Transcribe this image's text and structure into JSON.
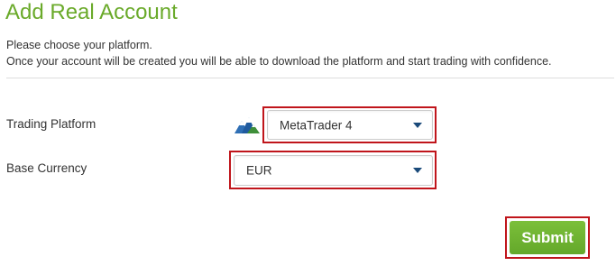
{
  "page": {
    "title": "Add Real Account",
    "intro_line_1": "Please choose your platform.",
    "intro_line_2": "Once your account will be created you will be able to download the platform and start trading with confidence."
  },
  "form": {
    "platform": {
      "label": "Trading Platform",
      "value": "MetaTrader 4",
      "icon": "metatrader-logo-icon"
    },
    "currency": {
      "label": "Base Currency",
      "value": "EUR"
    },
    "submit_label": "Submit"
  },
  "colors": {
    "title": "#6aaa2a",
    "submit_button": "#6fb431",
    "highlight_border": "#c0151b",
    "caret": "#1a4a7a"
  }
}
